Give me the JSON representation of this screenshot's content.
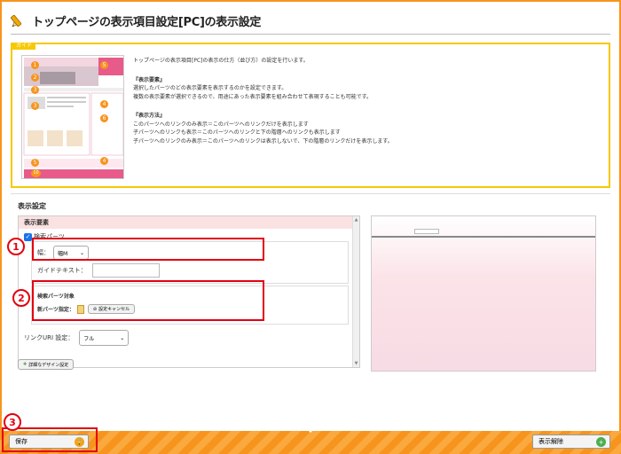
{
  "header": {
    "title": "トップページの表示項目設定[PC]の表示設定",
    "icon": "pencil-icon"
  },
  "guide": {
    "tag": "ガイド",
    "intro": "トップページの表示項目[PC]の表示の仕方（並び方）の設定を行います。",
    "section1_title": "『表示要素』",
    "section1_lines": [
      "選択したパーツのどの表示要素を表示するのかを設定できます。",
      "複数の表示要素が選択できるので、用途にあった表示要素を組み合わせて表現することも可能です。"
    ],
    "section2_title": "『表示方法』",
    "section2_lines": [
      "このパーツへのリンクのみ表示＝このパーツへのリンクだけを表示します",
      "子パーツへのリンクも表示＝このパーツへのリンクと下の階層へのリンクも表示します",
      "子パーツへのリンクのみ表示＝このパーツへのリンクは表示しないで、下の階層のリンクだけを表示します。"
    ],
    "thumb_numbers": [
      "1",
      "5",
      "2",
      "3",
      "4",
      "6",
      "3",
      "4",
      "5",
      "10"
    ]
  },
  "settings": {
    "title": "表示設定",
    "panel_header": "表示要素",
    "search_parts_label": "検索パーツ",
    "search_parts_checked": true,
    "width_label": "幅：",
    "width_value": "幅M",
    "guide_text_label": "ガイドテキスト：",
    "guide_text_value": "",
    "target_label": "検索パーツ対象",
    "new_parts_label": "新パーツ指定：",
    "cancel_setting_label": "設定キャンセル",
    "link_uri_label": "リンクURI 設定：",
    "link_uri_value": "フル",
    "add_design_label": "詳細なデザイン設定"
  },
  "annotations": [
    "1",
    "2",
    "3"
  ],
  "footer": {
    "save_label": "保存",
    "release_label": "表示解除"
  },
  "colors": {
    "accent": "#f7941d",
    "guide_border": "#f7c900",
    "annotation": "#e3000f",
    "panel_header": "#fbe2e2"
  }
}
